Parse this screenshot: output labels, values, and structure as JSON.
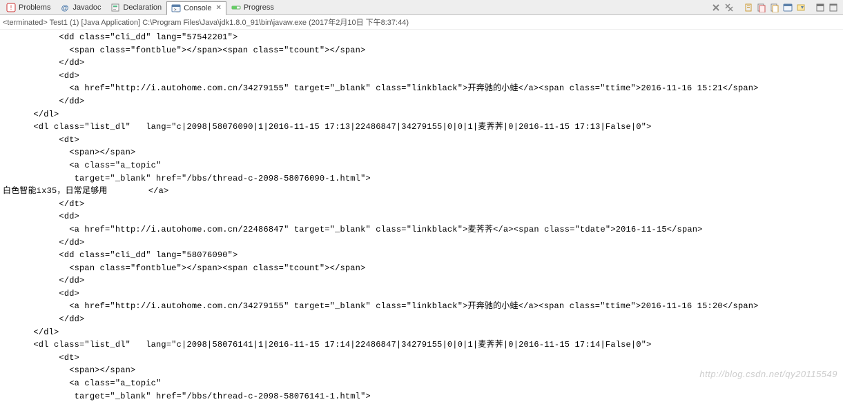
{
  "tabs": [
    {
      "label": "Problems",
      "icon": "problems"
    },
    {
      "label": "Javadoc",
      "icon": "javadoc"
    },
    {
      "label": "Declaration",
      "icon": "declaration"
    },
    {
      "label": "Console",
      "icon": "console",
      "active": true,
      "closable": true
    },
    {
      "label": "Progress",
      "icon": "progress"
    }
  ],
  "status": "<terminated> Test1 (1) [Java Application] C:\\Program Files\\Java\\jdk1.8.0_91\\bin\\javaw.exe (2017年2月10日 下午8:37:44)",
  "console_lines": [
    "           <dd class=\"cli_dd\" lang=\"57542201\">",
    "             <span class=\"fontblue\"></span><span class=\"tcount\"></span>",
    "           </dd>",
    "           <dd>",
    "             <a href=\"http://i.autohome.com.cn/34279155\" target=\"_blank\" class=\"linkblack\">开奔驰的小蛙</a><span class=\"ttime\">2016-11-16 15:21</span>",
    "           </dd>",
    "      </dl>",
    "      <dl class=\"list_dl\"   lang=\"c|2098|58076090|1|2016-11-15 17:13|22486847|34279155|0|0|1|麦荠荠|0|2016-11-15 17:13|False|0\">",
    "           <dt>",
    "             <span></span>",
    "             <a class=\"a_topic\"",
    "              target=\"_blank\" href=\"/bbs/thread-c-2098-58076090-1.html\">",
    "白色智能ix35，日常足够用        </a>",
    "           </dt>",
    "           <dd>",
    "             <a href=\"http://i.autohome.com.cn/22486847\" target=\"_blank\" class=\"linkblack\">麦荠荠</a><span class=\"tdate\">2016-11-15</span>",
    "           </dd>",
    "           <dd class=\"cli_dd\" lang=\"58076090\">",
    "             <span class=\"fontblue\"></span><span class=\"tcount\"></span>",
    "           </dd>",
    "           <dd>",
    "             <a href=\"http://i.autohome.com.cn/34279155\" target=\"_blank\" class=\"linkblack\">开奔驰的小蛙</a><span class=\"ttime\">2016-11-16 15:20</span>",
    "           </dd>",
    "      </dl>",
    "      <dl class=\"list_dl\"   lang=\"c|2098|58076141|1|2016-11-15 17:14|22486847|34279155|0|0|1|麦荠荠|0|2016-11-15 17:14|False|0\">",
    "           <dt>",
    "             <span></span>",
    "             <a class=\"a_topic\"",
    "              target=\"_blank\" href=\"/bbs/thread-c-2098-58076141-1.html\">"
  ],
  "watermark": "http://blog.csdn.net/qy20115549"
}
